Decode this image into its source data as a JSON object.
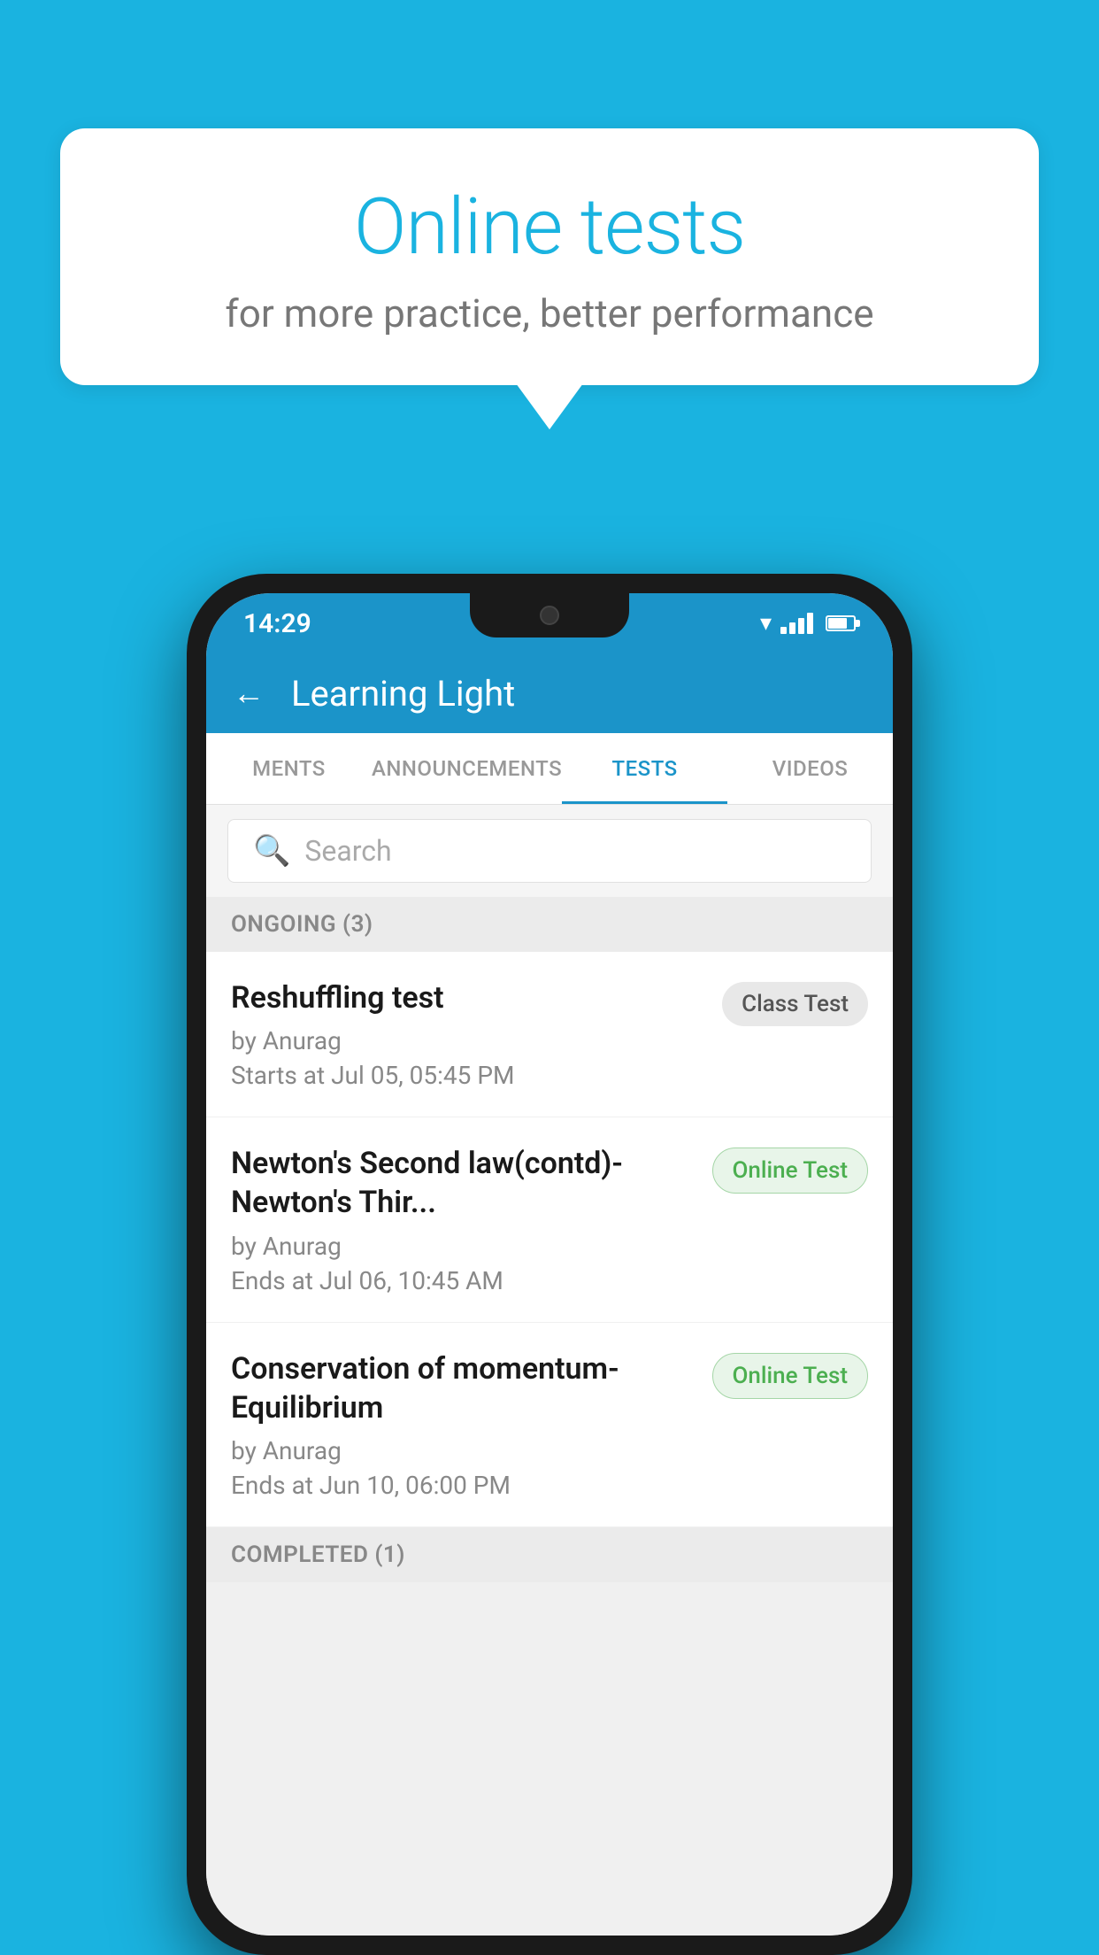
{
  "background_color": "#1ab3e0",
  "speech_bubble": {
    "title": "Online tests",
    "subtitle": "for more practice, better performance"
  },
  "status_bar": {
    "time": "14:29"
  },
  "app_header": {
    "title": "Learning Light",
    "back_label": "←"
  },
  "tabs": [
    {
      "label": "MENTS",
      "active": false
    },
    {
      "label": "ANNOUNCEMENTS",
      "active": false
    },
    {
      "label": "TESTS",
      "active": true
    },
    {
      "label": "VIDEOS",
      "active": false
    }
  ],
  "search": {
    "placeholder": "Search"
  },
  "ongoing_section": {
    "label": "ONGOING (3)"
  },
  "test_items": [
    {
      "name": "Reshuffling test",
      "by": "by Anurag",
      "time": "Starts at  Jul 05, 05:45 PM",
      "badge": "Class Test",
      "badge_type": "class"
    },
    {
      "name": "Newton's Second law(contd)-Newton's Thir...",
      "by": "by Anurag",
      "time": "Ends at  Jul 06, 10:45 AM",
      "badge": "Online Test",
      "badge_type": "online"
    },
    {
      "name": "Conservation of momentum-Equilibrium",
      "by": "by Anurag",
      "time": "Ends at  Jun 10, 06:00 PM",
      "badge": "Online Test",
      "badge_type": "online"
    }
  ],
  "completed_section": {
    "label": "COMPLETED (1)"
  }
}
